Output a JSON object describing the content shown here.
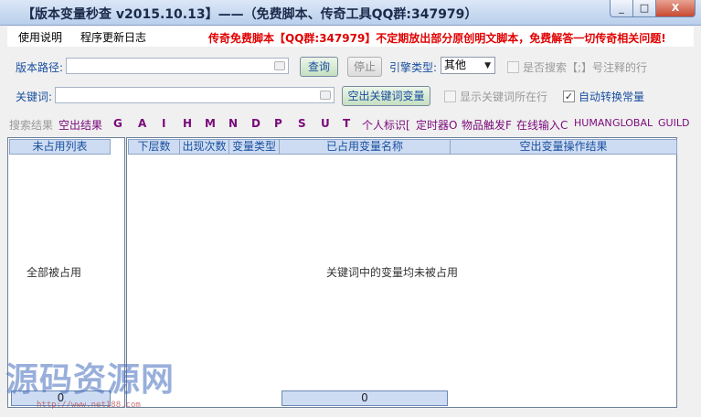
{
  "window": {
    "title": "【版本变量秒查 v2015.10.13】——（免费脚本、传奇工具QQ群:347979）",
    "controls": [
      "_",
      "□",
      "X"
    ]
  },
  "menu": {
    "items": [
      "使用说明",
      "程序更新日志"
    ],
    "banner": "传奇免费脚本【QQ群:347979】不定期放出部分原创明文脚本，免费解答一切传奇相关问题!"
  },
  "form": {
    "version_path_label": "版本路径:",
    "version_path_value": "",
    "query_button": "查询",
    "stop_button": "停止",
    "engine_type_label": "引擎类型:",
    "engine_type_value": "其他",
    "search_comment_label": "是否搜索【;】号注释的行",
    "keyword_label": "关键词:",
    "keyword_value": "",
    "find_vars_button": "空出关键词变量",
    "show_lines_label": "显示关键词所在行",
    "auto_convert_label": "自动转换常量"
  },
  "search_results": {
    "label": "搜索结果",
    "items": [
      "空出结果",
      "G",
      "A",
      "I",
      "H",
      "M",
      "N",
      "D",
      "P",
      "S",
      "U",
      "T",
      "个人标识[",
      "定时器O",
      "物品触发F",
      "在线输入C",
      "HUMAN",
      "GLOBAL",
      "GUILD"
    ]
  },
  "left_pane": {
    "header": "未占用列表",
    "empty_message": "全部被占用",
    "progress": "0"
  },
  "right_pane": {
    "columns": [
      "下层数",
      "出现次数",
      "变量类型",
      "已占用变量名称",
      "空出变量操作结果"
    ],
    "empty_message": "关键词中的变量均未被占用",
    "progress": "0"
  },
  "watermark": {
    "text": "源码资源网",
    "url": "http://www.net188.com"
  }
}
